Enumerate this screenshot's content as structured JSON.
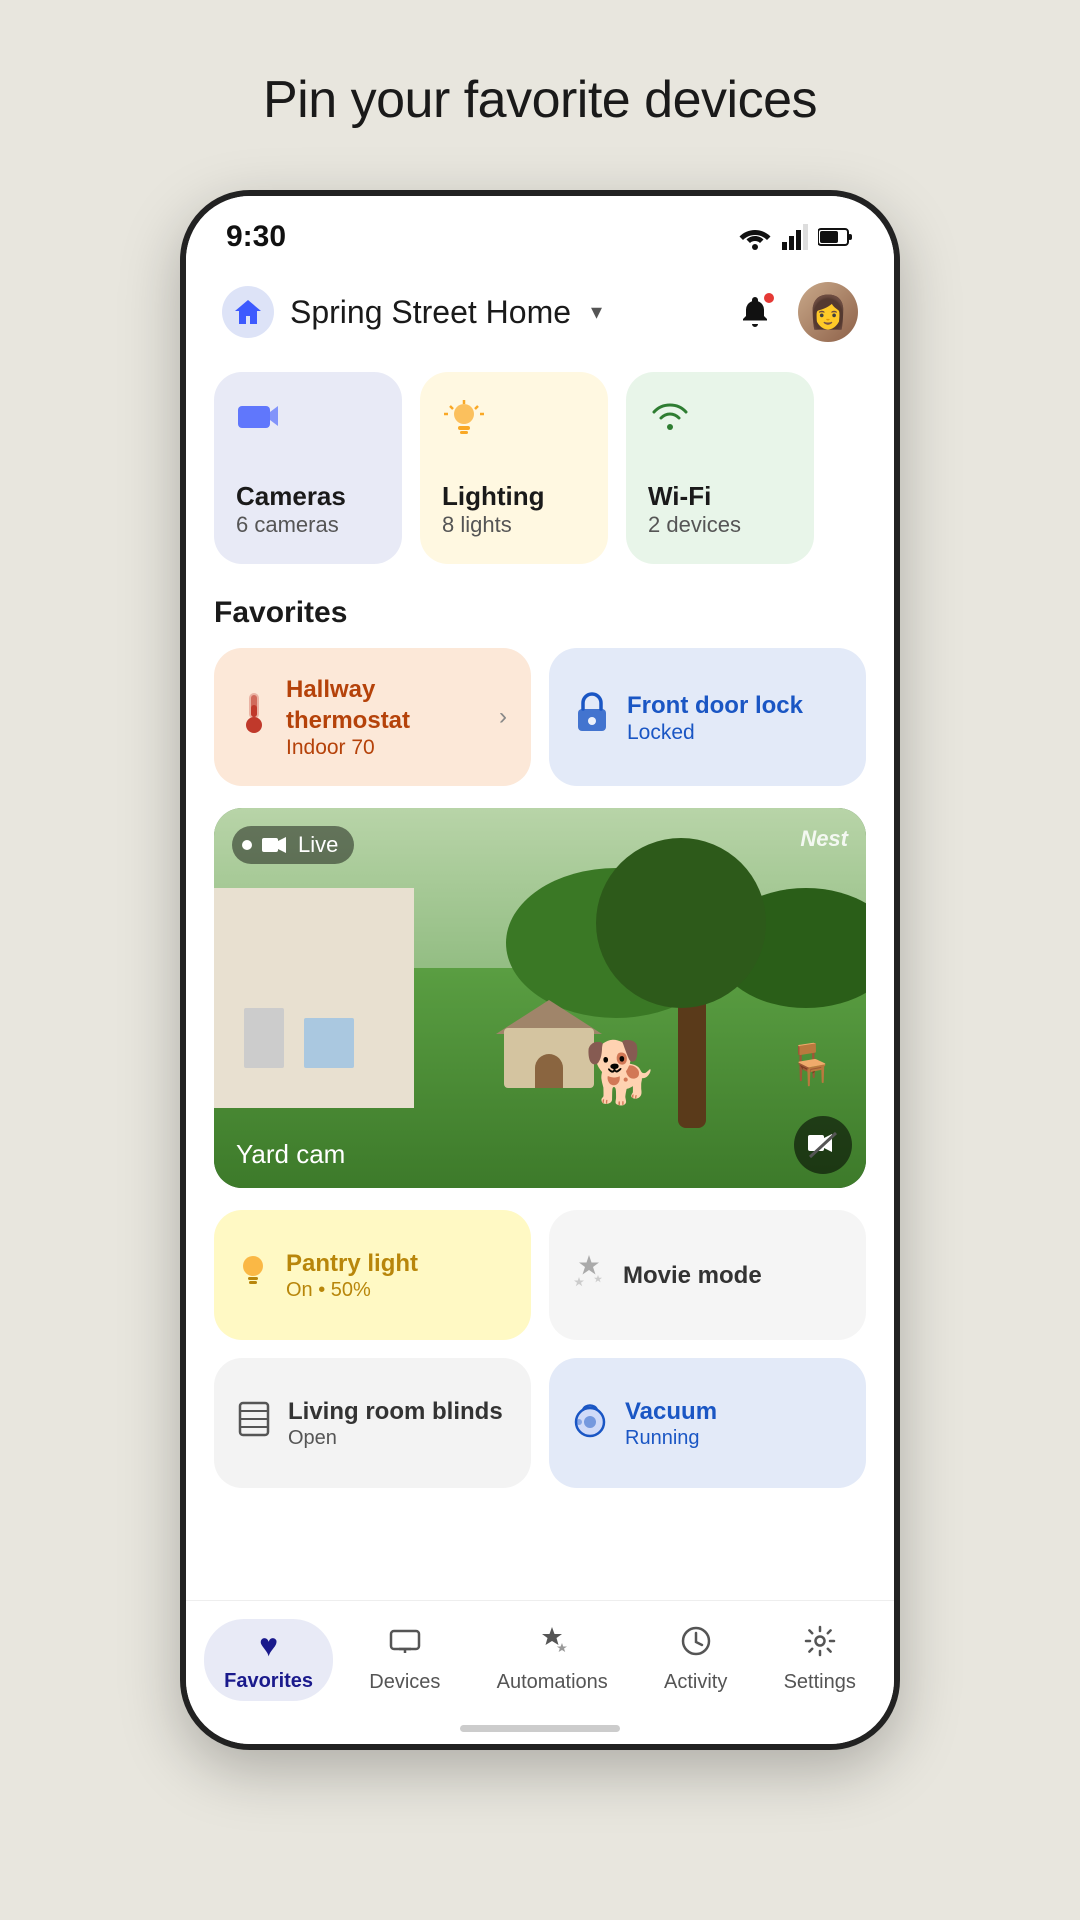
{
  "page": {
    "title": "Pin your favorite devices"
  },
  "status_bar": {
    "time": "9:30"
  },
  "header": {
    "home_name": "Spring Street Home",
    "chevron": "▾"
  },
  "categories": [
    {
      "id": "cameras",
      "icon": "🎥",
      "name": "Cameras",
      "sub": "6 cameras",
      "bg_class": "cameras"
    },
    {
      "id": "lighting",
      "icon": "💡",
      "name": "Lighting",
      "sub": "8 lights",
      "bg_class": "lighting"
    },
    {
      "id": "wifi",
      "icon": "📶",
      "name": "Wi-Fi",
      "sub": "2 devices",
      "bg_class": "wifi"
    }
  ],
  "section_favorites": {
    "label": "Favorites"
  },
  "favorite_cards": [
    {
      "id": "thermostat",
      "icon": "🌡️",
      "name": "Hallway thermostat",
      "status": "Indoor 70",
      "type": "thermostat"
    },
    {
      "id": "lock",
      "icon": "🔒",
      "name": "Front door lock",
      "status": "Locked",
      "type": "lock"
    }
  ],
  "camera_feed": {
    "live_label": "Live",
    "brand": "Nest",
    "label": "Yard cam"
  },
  "bottom_favorites": [
    {
      "id": "pantry",
      "icon": "💡",
      "name": "Pantry light",
      "sub": "On • 50%",
      "type": "pantry"
    },
    {
      "id": "movie",
      "icon": "✨",
      "name": "Movie mode",
      "sub": "",
      "type": "movie"
    },
    {
      "id": "blinds",
      "icon": "🪟",
      "name": "Living room blinds",
      "sub": "Open",
      "type": "blinds"
    },
    {
      "id": "vacuum",
      "icon": "🤖",
      "name": "Vacuum",
      "sub": "Running",
      "type": "vacuum"
    }
  ],
  "bottom_nav": [
    {
      "id": "favorites",
      "icon": "♥",
      "label": "Favorites",
      "active": true
    },
    {
      "id": "devices",
      "icon": "📱",
      "label": "Devices",
      "active": false
    },
    {
      "id": "automations",
      "icon": "✨",
      "label": "Automations",
      "active": false
    },
    {
      "id": "activity",
      "icon": "🕐",
      "label": "Activity",
      "active": false
    },
    {
      "id": "settings",
      "icon": "⚙️",
      "label": "Settings",
      "active": false
    }
  ]
}
